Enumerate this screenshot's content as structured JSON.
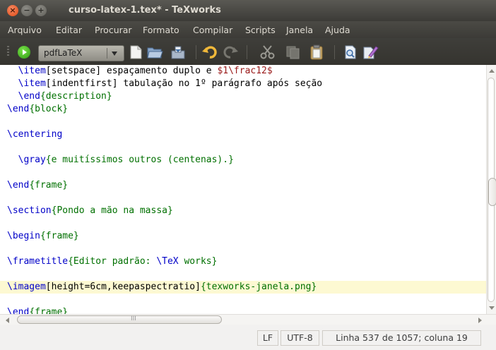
{
  "window": {
    "title": "curso-latex-1.tex* - TeXworks",
    "close_glyph": "×",
    "minimize_glyph": "−",
    "maximize_glyph": "+"
  },
  "menu": {
    "items": [
      "Arquivo",
      "Editar",
      "Procurar",
      "Formato",
      "Compilar",
      "Scripts",
      "Janela",
      "Ajuda"
    ]
  },
  "toolbar": {
    "engine": "pdfLaTeX",
    "icons": [
      "typeset-icon",
      "new-document-icon",
      "open-folder-icon",
      "save-icon",
      "undo-icon",
      "redo-icon",
      "cut-icon",
      "copy-icon",
      "paste-icon",
      "find-icon",
      "replace-icon"
    ]
  },
  "editor": {
    "lines": [
      [
        {
          "t": "  "
        },
        {
          "t": "\\item",
          "c": "cmd"
        },
        {
          "t": "[setspace] espaçamento duplo e "
        },
        {
          "t": "$1\\frac12$",
          "c": "math"
        }
      ],
      [
        {
          "t": "  "
        },
        {
          "t": "\\item",
          "c": "cmd"
        },
        {
          "t": "[indentfirst] tabulação no 1º parágrafo após seção"
        }
      ],
      [
        {
          "t": "  "
        },
        {
          "t": "\\end",
          "c": "cmd"
        },
        {
          "t": "{description}",
          "c": "arg"
        }
      ],
      [
        {
          "t": "\\end",
          "c": "cmd"
        },
        {
          "t": "{block}",
          "c": "arg"
        }
      ],
      [],
      [
        {
          "t": "\\centering",
          "c": "cmd"
        }
      ],
      [],
      [
        {
          "t": "  "
        },
        {
          "t": "\\gray",
          "c": "cmd"
        },
        {
          "t": "{e muitíssimos outros (centenas).}",
          "c": "arg"
        }
      ],
      [],
      [
        {
          "t": "\\end",
          "c": "cmd"
        },
        {
          "t": "{frame}",
          "c": "arg"
        }
      ],
      [],
      [
        {
          "t": "\\section",
          "c": "cmd"
        },
        {
          "t": "{Pondo a mão na massa}",
          "c": "arg"
        }
      ],
      [],
      [
        {
          "t": "\\begin",
          "c": "cmd"
        },
        {
          "t": "{frame}",
          "c": "arg"
        }
      ],
      [],
      [
        {
          "t": "\\frametitle",
          "c": "cmd"
        },
        {
          "t": "{Editor padrão: ",
          "c": "arg"
        },
        {
          "t": "\\TeX",
          "c": "cmd"
        },
        {
          "t": " works}",
          "c": "arg"
        }
      ],
      [],
      [
        {
          "t": "\\imagem",
          "c": "cmd"
        },
        {
          "t": "[height=6cm,keepaspectratio]"
        },
        {
          "t": "{texworks-janela.png}",
          "c": "arg"
        }
      ],
      [],
      [
        {
          "t": "\\end",
          "c": "cmd"
        },
        {
          "t": "{frame}",
          "c": "arg"
        }
      ]
    ],
    "current_line_index": 17,
    "colors": {
      "command": "#0000c8",
      "argument": "#007000",
      "math": "#9a1a1a",
      "current_line": "#fdf9d2"
    }
  },
  "scroll": {
    "vertical_position_fraction": 0.51,
    "horizontal_grip": "III"
  },
  "status": {
    "line_ending": "LF",
    "encoding": "UTF-8",
    "position": "Linha 537 de 1057; coluna 19"
  }
}
